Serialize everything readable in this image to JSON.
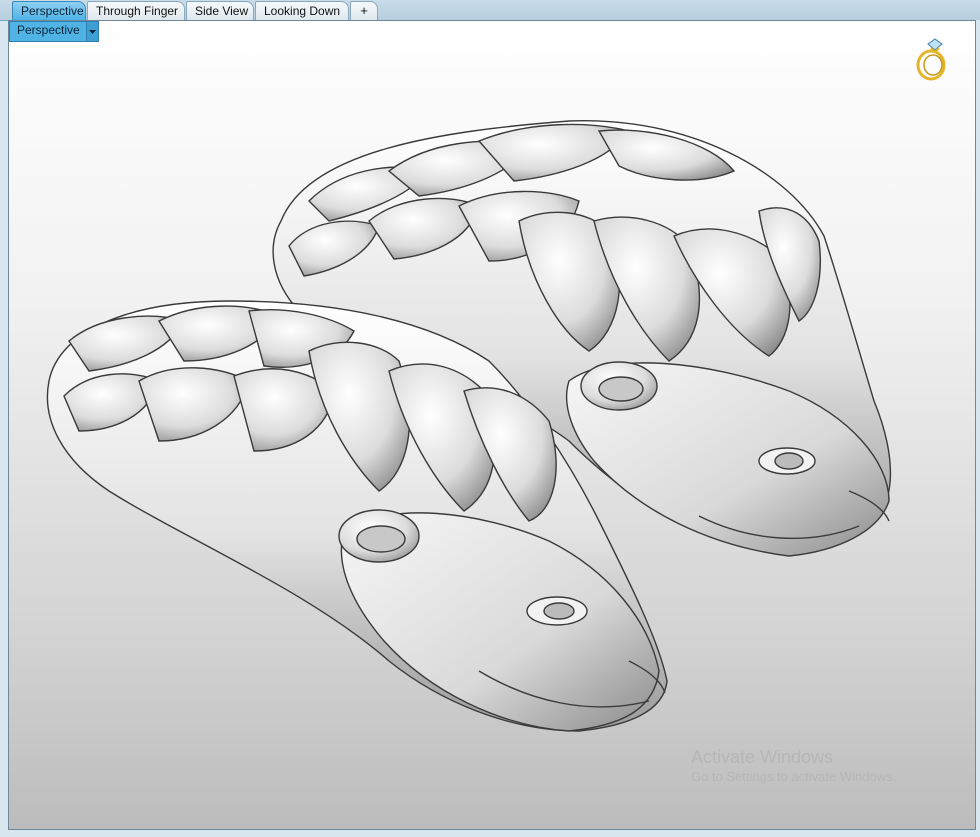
{
  "tabs": [
    {
      "label": "Perspective",
      "active": true
    },
    {
      "label": "Through Finger",
      "active": false
    },
    {
      "label": "Side View",
      "active": false
    },
    {
      "label": "Looking Down",
      "active": false
    }
  ],
  "add_tab_icon": "plus-icon",
  "viewport": {
    "dropdown_label": "Perspective",
    "dropdown_icon": "chevron-down-icon",
    "corner_icon": "ring-icon"
  },
  "watermark": {
    "title": "Activate Windows",
    "subtitle": "Go to Settings to activate Windows."
  },
  "colors": {
    "active_tab": "#4fb3e6",
    "tabbar": "#c8dce9",
    "ring": "#e3b52a"
  }
}
